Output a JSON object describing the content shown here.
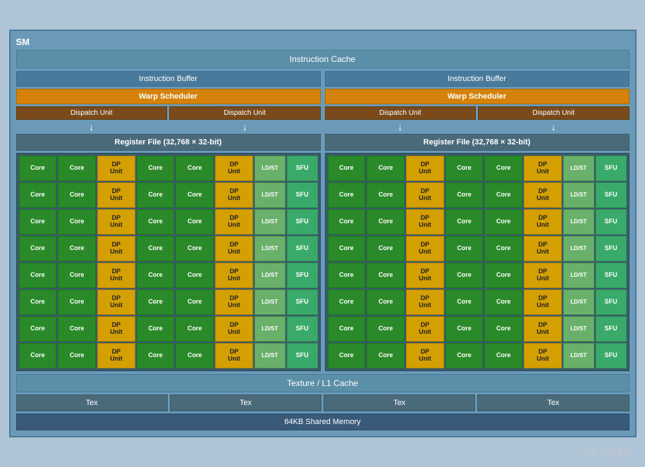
{
  "sm": {
    "label": "SM",
    "instruction_cache": "Instruction Cache",
    "left_half": {
      "instruction_buffer": "Instruction Buffer",
      "warp_scheduler": "Warp Scheduler",
      "dispatch_unit1": "Dispatch Unit",
      "dispatch_unit2": "Dispatch Unit",
      "register_file": "Register File (32,768 × 32-bit)"
    },
    "right_half": {
      "instruction_buffer": "Instruction Buffer",
      "warp_scheduler": "Warp Scheduler",
      "dispatch_unit1": "Dispatch Unit",
      "dispatch_unit2": "Dispatch Unit",
      "register_file": "Register File (32,768 × 32-bit)"
    },
    "core_label": "Core",
    "dp_label": "DP\nUnit",
    "ldst_label": "LD/ST",
    "sfu_label": "SFU",
    "rows": 8,
    "texture_l1_cache": "Texture / L1 Cache",
    "tex_units": [
      "Tex",
      "Tex",
      "Tex",
      "Tex"
    ],
    "shared_memory": "64KB Shared Memory",
    "watermark": "知乎 @捏太阳"
  }
}
